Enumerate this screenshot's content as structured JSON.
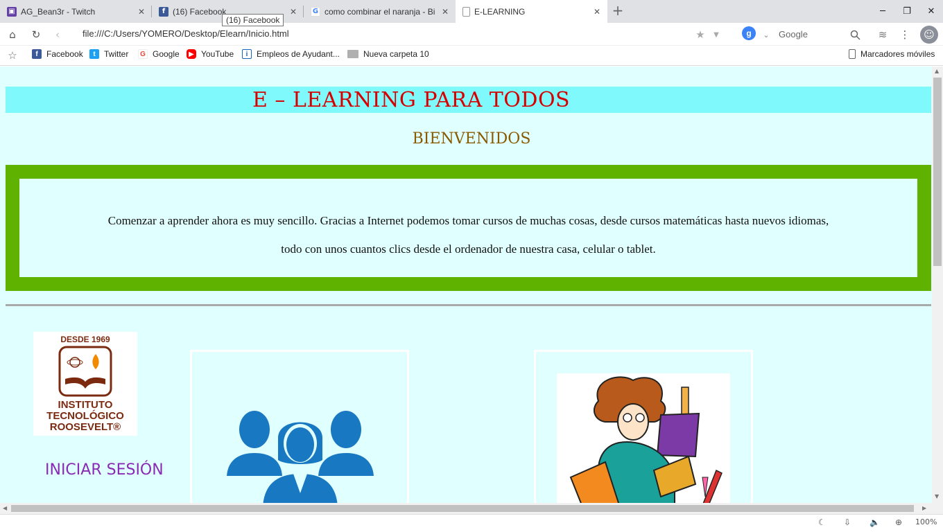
{
  "browser": {
    "tabs": [
      {
        "title": "AG_Bean3r - Twitch",
        "icon": "twitch-icon",
        "color": "#6441a5"
      },
      {
        "title": "(16) Facebook",
        "icon": "facebook-icon",
        "color": "#3b5998"
      },
      {
        "title": "como combinar el naranja - Bi",
        "icon": "google-icon",
        "color": "#4285f4"
      },
      {
        "title": "E-LEARNING",
        "icon": "document-icon",
        "color": "#777777"
      }
    ],
    "tooltip": "(16) Facebook",
    "url": "file:///C:/Users/YOMERO/Desktop/Elearn/Inicio.html",
    "search_engine_letter": "g",
    "search_placeholder": "Google",
    "zoom": "100%"
  },
  "bookmarks": {
    "items": [
      {
        "label": "Facebook",
        "icon": "facebook-icon",
        "color": "#3b5998"
      },
      {
        "label": "Twitter",
        "icon": "twitter-icon",
        "color": "#1da1f2"
      },
      {
        "label": "Google",
        "icon": "google-icon",
        "color": "#ea4335"
      },
      {
        "label": "YouTube",
        "icon": "youtube-icon",
        "color": "#ff0000"
      },
      {
        "label": "Empleos de Ayudant...",
        "icon": "info-icon",
        "color": "#1565c0"
      },
      {
        "label": "Nueva carpeta 10",
        "icon": "folder-icon",
        "color": "#9e9e9e"
      }
    ],
    "mobile_label": "Marcadores móviles"
  },
  "page": {
    "header_title": "E – LEARNING PARA TODOS",
    "welcome": "BIENVENIDOS",
    "intro_line1": "Comenzar a aprender ahora es muy sencillo. Gracias a Internet podemos tomar cursos de muchas cosas, desde cursos matemáticas hasta nuevos idiomas,",
    "intro_line2": "todo con unos cuantos clics desde el ordenador de nuestra casa, celular o tablet.",
    "logo": {
      "since": "DESDE 1969",
      "name_line1": "INSTITUTO",
      "name_line2": "TECNOLÓGICO",
      "name_line3": "ROOSEVELT®"
    },
    "login_link": "INICIAR SESIÓN",
    "colors": {
      "header_bg": "#7ff9fb",
      "header_text": "#d60000",
      "welcome_text": "#8a5a00",
      "green_frame": "#5fb300",
      "page_bg": "#e0ffff",
      "login_text": "#8a2bb5",
      "people_icon": "#1878c2"
    }
  }
}
